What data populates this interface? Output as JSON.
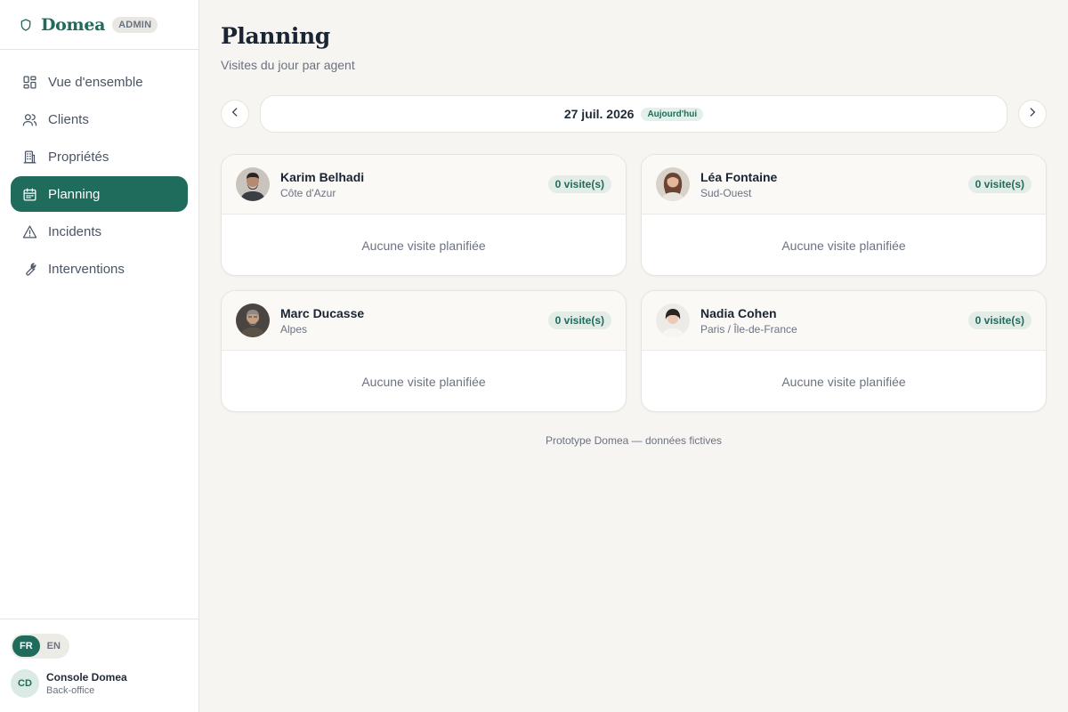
{
  "sidebar": {
    "brand": "Domea",
    "badge": "ADMIN",
    "items": [
      {
        "label": "Vue d'ensemble",
        "icon": "dashboard-icon"
      },
      {
        "label": "Clients",
        "icon": "users-icon"
      },
      {
        "label": "Propriétés",
        "icon": "building-icon"
      },
      {
        "label": "Planning",
        "icon": "calendar-icon",
        "active": true
      },
      {
        "label": "Incidents",
        "icon": "warning-icon"
      },
      {
        "label": "Interventions",
        "icon": "wrench-icon"
      }
    ],
    "languages": [
      "FR",
      "EN"
    ],
    "active_language": "FR",
    "console": {
      "initials": "CD",
      "title": "Console Domea",
      "subtitle": "Back-office"
    }
  },
  "page": {
    "title": "Planning",
    "subtitle": "Visites du jour par agent",
    "date": "27 juil. 2026",
    "today_badge": "Aujourd'hui"
  },
  "agents": [
    {
      "name": "Karim Belhadi",
      "region": "Côte d'Azur",
      "visits": "0 visite(s)",
      "empty": "Aucune visite planifiée"
    },
    {
      "name": "Léa Fontaine",
      "region": "Sud-Ouest",
      "visits": "0 visite(s)",
      "empty": "Aucune visite planifiée"
    },
    {
      "name": "Marc Ducasse",
      "region": "Alpes",
      "visits": "0 visite(s)",
      "empty": "Aucune visite planifiée"
    },
    {
      "name": "Nadia Cohen",
      "region": "Paris / Île-de-France",
      "visits": "0 visite(s)",
      "empty": "Aucune visite planifiée"
    }
  ],
  "footer": "Prototype Domea — données fictives",
  "colors": {
    "accent": "#1f6b5c",
    "background": "#f6f5f1"
  }
}
